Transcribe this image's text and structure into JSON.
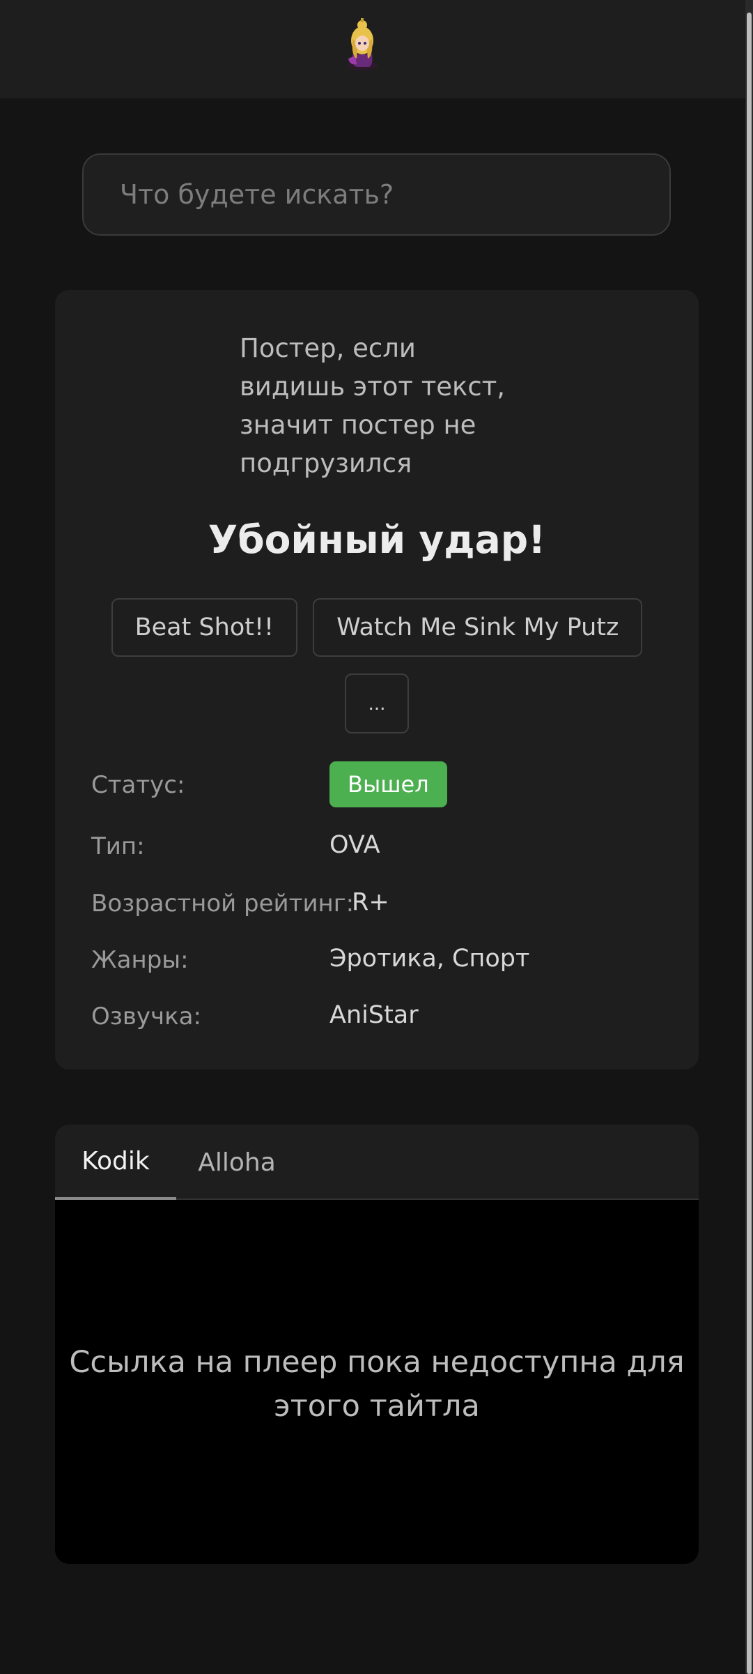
{
  "header": {
    "logo_icon": "chibi-character-logo-icon"
  },
  "search": {
    "placeholder": "Что будете искать?",
    "value": ""
  },
  "anime": {
    "poster_alt": "Постер, если видишь этот текст, значит постер не подгрузился",
    "title": "Убойный удар!",
    "alt_titles": [
      "Beat Shot!!",
      "Watch Me Sink My Putz"
    ],
    "more_label": "...",
    "info": {
      "status_label": "Статус:",
      "status_value": "Вышел",
      "type_label": "Тип:",
      "type_value": "OVA",
      "rating_label": "Возрастной рейтинг:",
      "rating_value": "R+",
      "genres_label": "Жанры:",
      "genres_value": "Эротика, Спорт",
      "dub_label": "Озвучка:",
      "dub_value": "AniStar"
    }
  },
  "player": {
    "tabs": [
      {
        "label": "Kodik",
        "active": true
      },
      {
        "label": "Alloha",
        "active": false
      }
    ],
    "message": "Ссылка на плеер пока недоступна для этого тайтла"
  },
  "colors": {
    "background": "#141414",
    "card": "#1e1e1e",
    "status_green": "#4caf50"
  }
}
